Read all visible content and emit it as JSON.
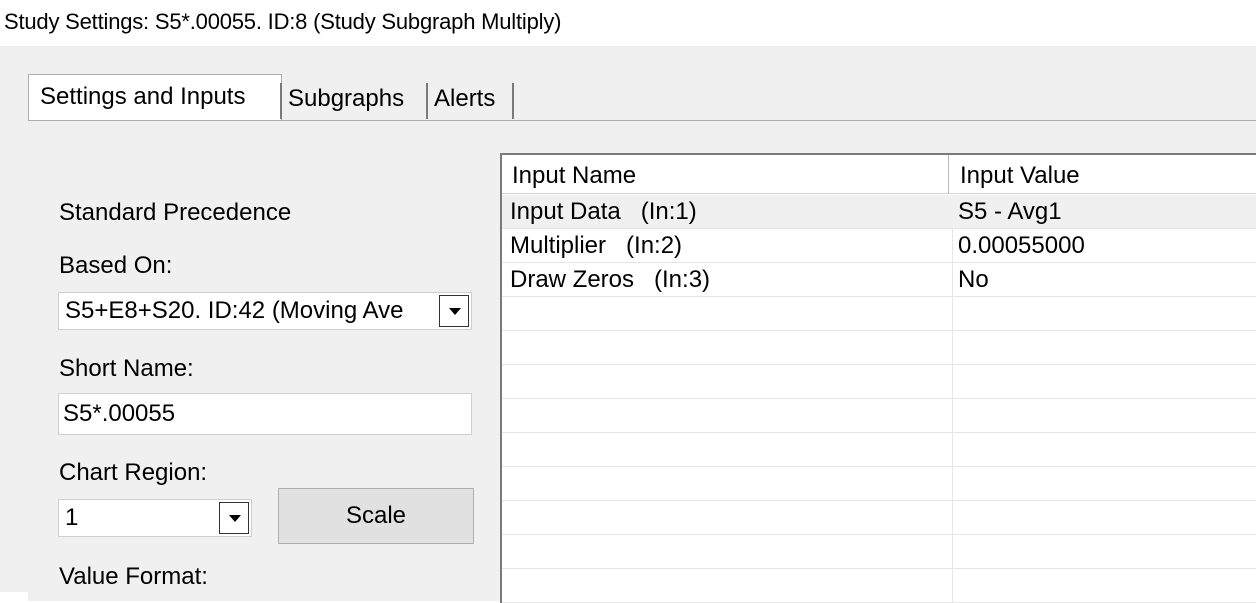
{
  "window": {
    "title": "Study Settings: S5*.00055. ID:8 (Study Subgraph Multiply)"
  },
  "tabs": [
    {
      "label": "Settings and Inputs",
      "active": true
    },
    {
      "label": "Subgraphs",
      "active": false
    },
    {
      "label": "Alerts",
      "active": false
    }
  ],
  "settings": {
    "precedence_label": "Standard Precedence",
    "based_on_label": "Based On:",
    "based_on_value": "S5+E8+S20. ID:42 (Moving Ave",
    "short_name_label": "Short Name:",
    "short_name_value": "S5*.00055",
    "chart_region_label": "Chart Region:",
    "chart_region_value": "1",
    "scale_button": "Scale",
    "value_format_label": "Value Format:"
  },
  "inputs_table": {
    "columns": [
      "Input Name",
      "Input Value"
    ],
    "rows": [
      {
        "name": "Input Data   (In:1)",
        "value": "S5 - Avg1"
      },
      {
        "name": "Multiplier   (In:2)",
        "value": "0.00055000"
      },
      {
        "name": "Draw Zeros   (In:3)",
        "value": "No"
      }
    ]
  },
  "icons": {
    "dropdown": "chevron-down-icon"
  }
}
